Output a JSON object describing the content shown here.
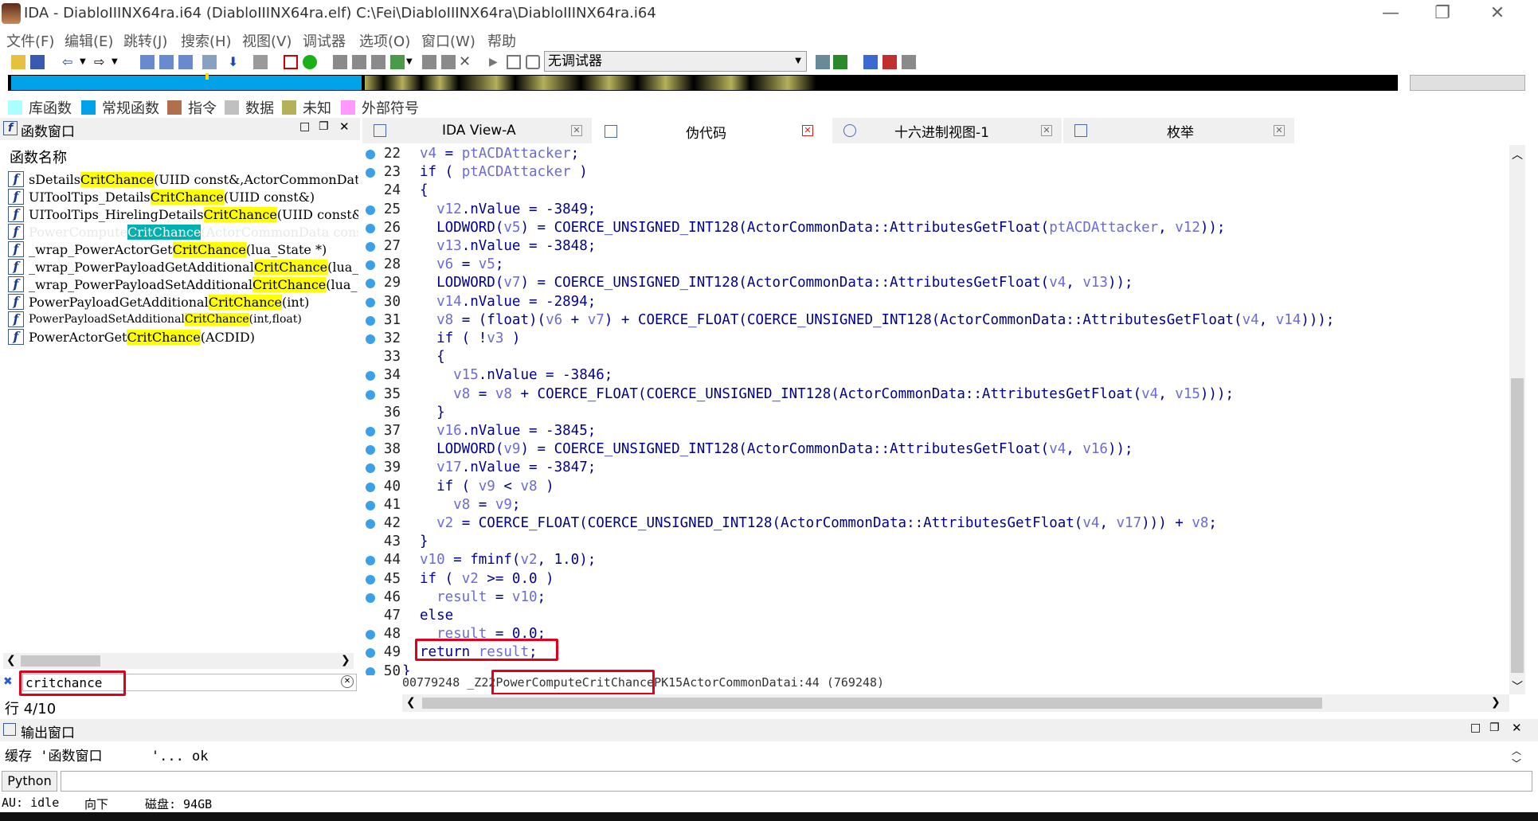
{
  "window": {
    "title": "IDA - DiabloIIINX64ra.i64 (DiabloIIINX64ra.elf) C:\\Fei\\DiabloIIINX64ra\\DiabloIIINX64ra.i64",
    "minimize": "—",
    "restore": "❐",
    "close": "✕"
  },
  "menu": [
    "文件(F)",
    "编辑(E)",
    "跳转(J)",
    "搜索(H)",
    "视图(V)",
    "调试器",
    "选项(O)",
    "窗口(W)",
    "帮助"
  ],
  "toolbar": {
    "debugger_select": "无调试器"
  },
  "legend": [
    {
      "label": "库函数",
      "color": "#aaffff"
    },
    {
      "label": "常规函数",
      "color": "#00a2e8"
    },
    {
      "label": "指令",
      "color": "#b07050"
    },
    {
      "label": "数据",
      "color": "#c0c0c0"
    },
    {
      "label": "未知",
      "color": "#b5b05a"
    },
    {
      "label": "外部符号",
      "color": "#ff99ff"
    }
  ],
  "functions_panel": {
    "title": "函数窗口",
    "column": "函数名称",
    "items": [
      {
        "pre": "sDetails",
        "hl": "CritChance",
        "post": "(UIID const&,ActorCommonData const*,"
      },
      {
        "pre": "UIToolTips_Details",
        "hl": "CritChance",
        "post": "(UIID const&)"
      },
      {
        "pre": "UIToolTips_HirelingDetails",
        "hl": "CritChance",
        "post": "(UIID const&)"
      },
      {
        "pre": "PowerCompute",
        "hl": "CritChance",
        "post": "(ActorCommonData const*)"
      },
      {
        "pre": "_wrap_PowerActorGet",
        "hl": "CritChance",
        "post": "(lua_State *)"
      },
      {
        "pre": "_wrap_PowerPayloadGetAdditional",
        "hl": "CritChance",
        "post": "(lua_State *)"
      },
      {
        "pre": "_wrap_PowerPayloadSetAdditional",
        "hl": "CritChance",
        "post": "(lua_State *)"
      },
      {
        "pre": "PowerPayloadGetAdditional",
        "hl": "CritChance",
        "post": "(int)"
      },
      {
        "pre": "PowerPayloadSetAdditional",
        "hl": "CritChance",
        "post": "(int,float)"
      },
      {
        "pre": "PowerActorGet",
        "hl": "CritChance",
        "post": "(ACDID)"
      }
    ],
    "filter": "critchance",
    "row_count": "行 4/10"
  },
  "tabs": [
    {
      "label": "IDA View-A"
    },
    {
      "label": "伪代码"
    },
    {
      "label": "十六进制视图-1"
    },
    {
      "label": "枚举"
    }
  ],
  "code": {
    "lines": [
      {
        "n": "22",
        "dot": true,
        "text": "v4 = ptACDAttacker;"
      },
      {
        "n": "23",
        "dot": true,
        "text": "if ( ptACDAttacker )"
      },
      {
        "n": "24",
        "dot": false,
        "text": "{"
      },
      {
        "n": "25",
        "dot": true,
        "text": "  v12.nValue = -3849;"
      },
      {
        "n": "26",
        "dot": true,
        "text": "  LODWORD(v5) = COERCE_UNSIGNED_INT128(ActorCommonData::AttributesGetFloat(ptACDAttacker, v12));"
      },
      {
        "n": "27",
        "dot": true,
        "text": "  v13.nValue = -3848;"
      },
      {
        "n": "28",
        "dot": true,
        "text": "  v6 = v5;"
      },
      {
        "n": "29",
        "dot": true,
        "text": "  LODWORD(v7) = COERCE_UNSIGNED_INT128(ActorCommonData::AttributesGetFloat(v4, v13));"
      },
      {
        "n": "30",
        "dot": true,
        "text": "  v14.nValue = -2894;"
      },
      {
        "n": "31",
        "dot": true,
        "text": "  v8 = (float)(v6 + v7) + COERCE_FLOAT(COERCE_UNSIGNED_INT128(ActorCommonData::AttributesGetFloat(v4, v14)));"
      },
      {
        "n": "32",
        "dot": true,
        "text": "  if ( !v3 )"
      },
      {
        "n": "33",
        "dot": false,
        "text": "  {"
      },
      {
        "n": "34",
        "dot": true,
        "text": "    v15.nValue = -3846;"
      },
      {
        "n": "35",
        "dot": true,
        "text": "    v8 = v8 + COERCE_FLOAT(COERCE_UNSIGNED_INT128(ActorCommonData::AttributesGetFloat(v4, v15)));"
      },
      {
        "n": "36",
        "dot": false,
        "text": "  }"
      },
      {
        "n": "37",
        "dot": true,
        "text": "  v16.nValue = -3845;"
      },
      {
        "n": "38",
        "dot": true,
        "text": "  LODWORD(v9) = COERCE_UNSIGNED_INT128(ActorCommonData::AttributesGetFloat(v4, v16));"
      },
      {
        "n": "39",
        "dot": true,
        "text": "  v17.nValue = -3847;"
      },
      {
        "n": "40",
        "dot": true,
        "text": "  if ( v9 < v8 )"
      },
      {
        "n": "41",
        "dot": true,
        "text": "    v8 = v9;"
      },
      {
        "n": "42",
        "dot": true,
        "text": "  v2 = COERCE_FLOAT(COERCE_UNSIGNED_INT128(ActorCommonData::AttributesGetFloat(v4, v17))) + v8;"
      },
      {
        "n": "43",
        "dot": false,
        "text": "}"
      },
      {
        "n": "44",
        "dot": true,
        "text": "v10 = fminf(v2, 1.0);"
      },
      {
        "n": "45",
        "dot": true,
        "text": "if ( v2 >= 0.0 )"
      },
      {
        "n": "46",
        "dot": true,
        "text": "  result = v10;"
      },
      {
        "n": "47",
        "dot": false,
        "text": "else"
      },
      {
        "n": "48",
        "dot": true,
        "text": "  result = 0.0;"
      },
      {
        "n": "49",
        "dot": true,
        "text": "return result;"
      },
      {
        "n": "50",
        "dot": true,
        "text": "}"
      }
    ],
    "status_pre": "00779248 _Z22",
    "status_hl": "PowerComputeCritChance",
    "status_post": "PK15ActorCommonDatai:44 (769248)"
  },
  "output_panel": {
    "title": "输出窗口",
    "line": "缓存 '函数窗口      '... ok",
    "python_button": "Python"
  },
  "statusbar": {
    "au": "AU:  idle",
    "dir": "向下",
    "disk": "磁盘: 94GB"
  }
}
